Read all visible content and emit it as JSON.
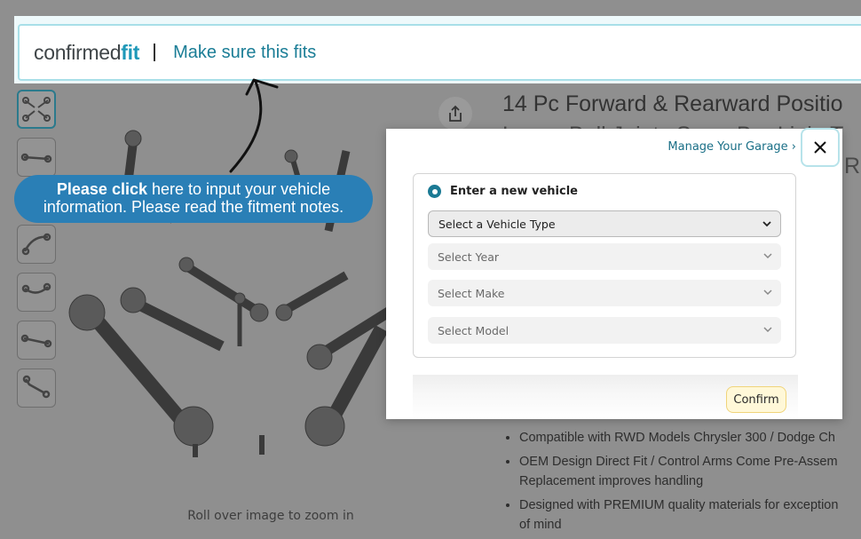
{
  "header": {
    "logo_prefix": "confirmed",
    "logo_suffix": "fit",
    "make_sure_text": "Make sure this fits"
  },
  "tooltip": {
    "bold": "Please click",
    "line1_rest": " here to input your vehicle",
    "line2": "information. Please read the fitment notes."
  },
  "product": {
    "title_line1": "14 Pc Forward & Rearward Positio",
    "title_line2": "Lower Ball Joints Sway Bar Link, T",
    "title_line3": "R",
    "zoom_hint": "Roll over image to zoom in",
    "bullets": [
      {
        "line1": "Compatible with RWD Models Chrysler 300 / Dodge Ch",
        "line2": ""
      },
      {
        "line1": "OEM Design Direct Fit / Control Arms Come Pre-Assem",
        "line2": "Replacement improves handling"
      },
      {
        "line1": "Designed with PREMIUM quality materials for exception",
        "line2": "of mind"
      }
    ]
  },
  "modal": {
    "manage_link": "Manage Your Garage ›",
    "close_label": "✕",
    "radio_label": "Enter a new vehicle",
    "selects": {
      "vehicle_type": "Select a Vehicle Type",
      "year": "Select Year",
      "make": "Select Make",
      "model": "Select Model"
    },
    "confirm_label": "Confirm"
  },
  "colors": {
    "accent": "#1b7a94",
    "tooltip_bg": "#2a7fb6",
    "confirm_bg": "#fff8d8"
  }
}
